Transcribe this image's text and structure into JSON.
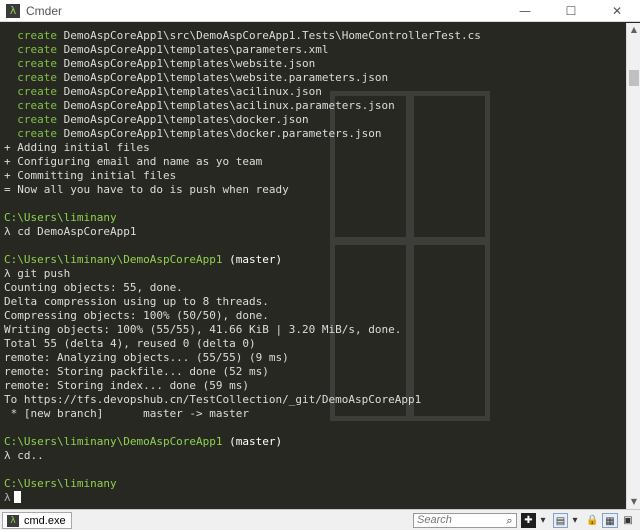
{
  "window": {
    "title": "Cmder",
    "app_icon": "λ",
    "minimize": "—",
    "maximize": "☐",
    "close": "✕"
  },
  "console": {
    "create_lines": [
      {
        "kw": "create",
        "text": "DemoAspCoreApp1\\src\\DemoAspCoreApp1.Tests\\HomeControllerTest.cs"
      },
      {
        "kw": "create",
        "text": "DemoAspCoreApp1\\templates\\parameters.xml"
      },
      {
        "kw": "create",
        "text": "DemoAspCoreApp1\\templates\\website.json"
      },
      {
        "kw": "create",
        "text": "DemoAspCoreApp1\\templates\\website.parameters.json"
      },
      {
        "kw": "create",
        "text": "DemoAspCoreApp1\\templates\\acilinux.json"
      },
      {
        "kw": "create",
        "text": "DemoAspCoreApp1\\templates\\acilinux.parameters.json"
      },
      {
        "kw": "create",
        "text": "DemoAspCoreApp1\\templates\\docker.json"
      },
      {
        "kw": "create",
        "text": "DemoAspCoreApp1\\templates\\docker.parameters.json"
      }
    ],
    "status_lines": [
      "+ Adding initial files",
      "+ Configuring email and name as yo team",
      "+ Committing initial files",
      "= Now all you have to do is push when ready"
    ],
    "prompt1_path": "C:\\Users\\liminany",
    "prompt1_cmd": "λ cd DemoAspCoreApp1",
    "prompt2_path": "C:\\Users\\liminany\\DemoAspCoreApp1",
    "prompt2_branch": " (master)",
    "prompt2_cmd": "λ git push",
    "push_output": [
      "Counting objects: 55, done.",
      "Delta compression using up to 8 threads.",
      "Compressing objects: 100% (50/50), done.",
      "Writing objects: 100% (55/55), 41.66 KiB | 3.20 MiB/s, done.",
      "Total 55 (delta 4), reused 0 (delta 0)",
      "remote: Analyzing objects... (55/55) (9 ms)",
      "remote: Storing packfile... done (52 ms)",
      "remote: Storing index... done (59 ms)",
      "To https://tfs.devopshub.cn/TestCollection/_git/DemoAspCoreApp1",
      " * [new branch]      master -> master"
    ],
    "prompt3_path": "C:\\Users\\liminany\\DemoAspCoreApp1",
    "prompt3_branch": " (master)",
    "prompt3_cmd": "λ cd..",
    "prompt4_path": "C:\\Users\\liminany",
    "prompt4_lambda": "λ"
  },
  "scrollbar": {
    "up": "▲",
    "down": "▼"
  },
  "statusbar": {
    "tab_label": "cmd.exe",
    "search_placeholder": "Search",
    "search_glyph": "⌕"
  },
  "colors": {
    "console_bg": "#272822",
    "prompt_green": "#8fd14f",
    "create_green": "#7fc242"
  }
}
